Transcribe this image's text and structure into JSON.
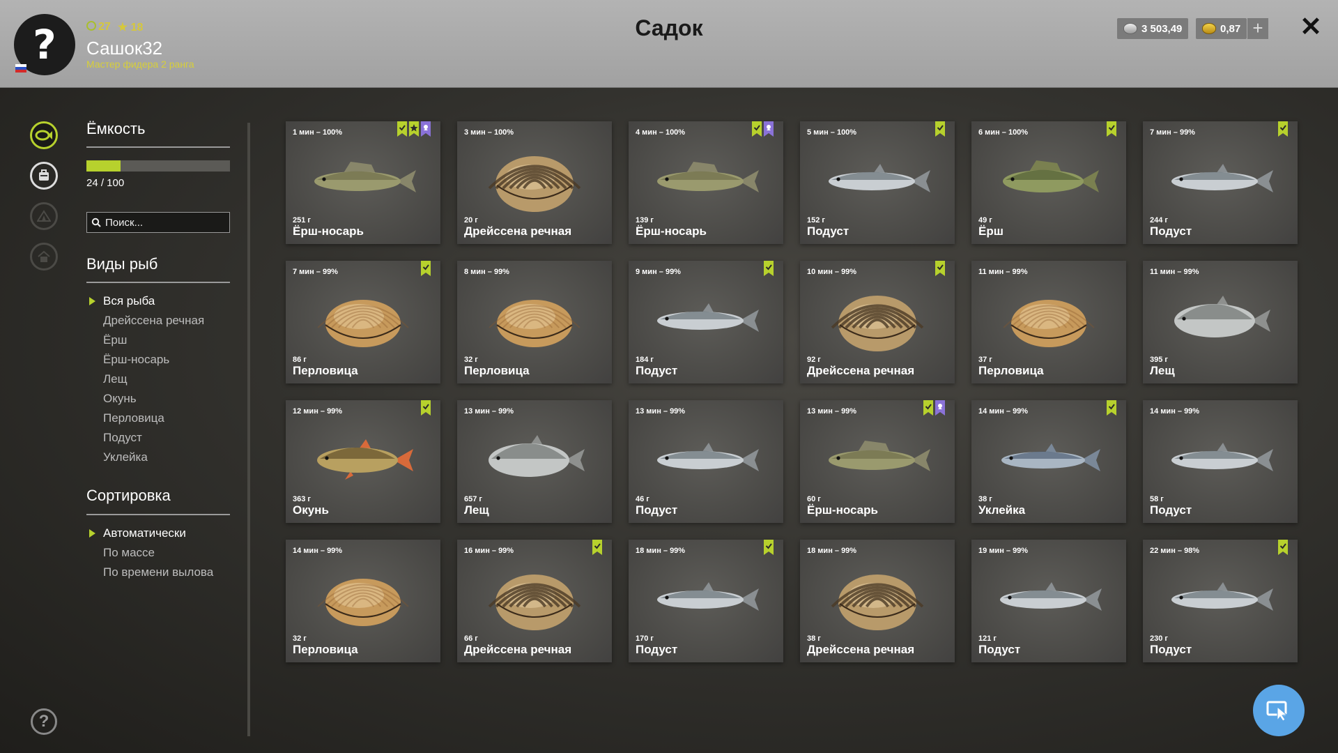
{
  "header": {
    "avatar_glyph": "?",
    "level": "27",
    "stars": "18",
    "username": "Сашок32",
    "rank": "Мастер фидера 2 ранга",
    "title": "Садок",
    "silver": "3 503,49",
    "gold": "0,87",
    "plus": "+",
    "close": "✕"
  },
  "sidebar": {
    "capacity_title": "Ёмкость",
    "capacity_fraction": 0.24,
    "capacity_text": "24 / 100",
    "search_placeholder": "Поиск...",
    "species_title": "Виды рыб",
    "species": [
      "Вся рыба",
      "Дрейссена речная",
      "Ёрш",
      "Ёрш-носарь",
      "Лещ",
      "Окунь",
      "Перловица",
      "Подуст",
      "Уклейка"
    ],
    "selected_species": 0,
    "sort_title": "Сортировка",
    "sort": [
      "Автоматически",
      "По массе",
      "По времени вылова"
    ],
    "selected_sort": 0
  },
  "colors": {
    "accent": "#b7d12d",
    "purple": "#8a72d8",
    "star": "#d9c236",
    "fab": "#5aa5e6"
  },
  "cards": [
    {
      "time": "1 мин – 100%",
      "weight": "251 г",
      "name": "Ёрш-носарь",
      "kind": "ruffe",
      "badges": [
        "green",
        "star",
        "purple"
      ]
    },
    {
      "time": "3 мин – 100%",
      "weight": "20 г",
      "name": "Дрейссена речная",
      "kind": "zebra",
      "badges": []
    },
    {
      "time": "4 мин – 100%",
      "weight": "139 г",
      "name": "Ёрш-носарь",
      "kind": "ruffe",
      "badges": [
        "green",
        "purple"
      ]
    },
    {
      "time": "5 мин – 100%",
      "weight": "152 г",
      "name": "Подуст",
      "kind": "silver",
      "badges": [
        "green"
      ]
    },
    {
      "time": "6 мин – 100%",
      "weight": "49 г",
      "name": "Ёрш",
      "kind": "ruffe2",
      "badges": [
        "green"
      ]
    },
    {
      "time": "7 мин – 99%",
      "weight": "244 г",
      "name": "Подуст",
      "kind": "silver",
      "badges": [
        "green"
      ]
    },
    {
      "time": "7 мин – 99%",
      "weight": "86 г",
      "name": "Перловица",
      "kind": "mussel",
      "badges": [
        "green"
      ]
    },
    {
      "time": "8 мин – 99%",
      "weight": "32 г",
      "name": "Перловица",
      "kind": "mussel",
      "badges": []
    },
    {
      "time": "9 мин – 99%",
      "weight": "184 г",
      "name": "Подуст",
      "kind": "silver",
      "badges": [
        "green"
      ]
    },
    {
      "time": "10 мин – 99%",
      "weight": "92 г",
      "name": "Дрейссена речная",
      "kind": "zebra",
      "badges": [
        "green"
      ]
    },
    {
      "time": "11 мин – 99%",
      "weight": "37 г",
      "name": "Перловица",
      "kind": "mussel",
      "badges": []
    },
    {
      "time": "11 мин – 99%",
      "weight": "395 г",
      "name": "Лещ",
      "kind": "bream",
      "badges": []
    },
    {
      "time": "12 мин – 99%",
      "weight": "363 г",
      "name": "Окунь",
      "kind": "perch",
      "badges": [
        "green"
      ]
    },
    {
      "time": "13 мин – 99%",
      "weight": "657 г",
      "name": "Лещ",
      "kind": "bream",
      "badges": []
    },
    {
      "time": "13 мин – 99%",
      "weight": "46 г",
      "name": "Подуст",
      "kind": "silver",
      "badges": []
    },
    {
      "time": "13 мин – 99%",
      "weight": "60 г",
      "name": "Ёрш-носарь",
      "kind": "ruffe",
      "badges": [
        "green",
        "purple"
      ]
    },
    {
      "time": "14 мин – 99%",
      "weight": "38 г",
      "name": "Уклейка",
      "kind": "bleak",
      "badges": [
        "green"
      ]
    },
    {
      "time": "14 мин – 99%",
      "weight": "58 г",
      "name": "Подуст",
      "kind": "silver",
      "badges": []
    },
    {
      "time": "14 мин – 99%",
      "weight": "32 г",
      "name": "Перловица",
      "kind": "mussel",
      "badges": []
    },
    {
      "time": "16 мин – 99%",
      "weight": "66 г",
      "name": "Дрейссена речная",
      "kind": "zebra",
      "badges": [
        "green"
      ]
    },
    {
      "time": "18 мин – 99%",
      "weight": "170 г",
      "name": "Подуст",
      "kind": "silver",
      "badges": [
        "green"
      ]
    },
    {
      "time": "18 мин – 99%",
      "weight": "38 г",
      "name": "Дрейссена речная",
      "kind": "zebra",
      "badges": []
    },
    {
      "time": "19 мин – 99%",
      "weight": "121 г",
      "name": "Подуст",
      "kind": "silver",
      "badges": []
    },
    {
      "time": "22 мин – 98%",
      "weight": "230 г",
      "name": "Подуст",
      "kind": "silver",
      "badges": [
        "green"
      ]
    }
  ]
}
